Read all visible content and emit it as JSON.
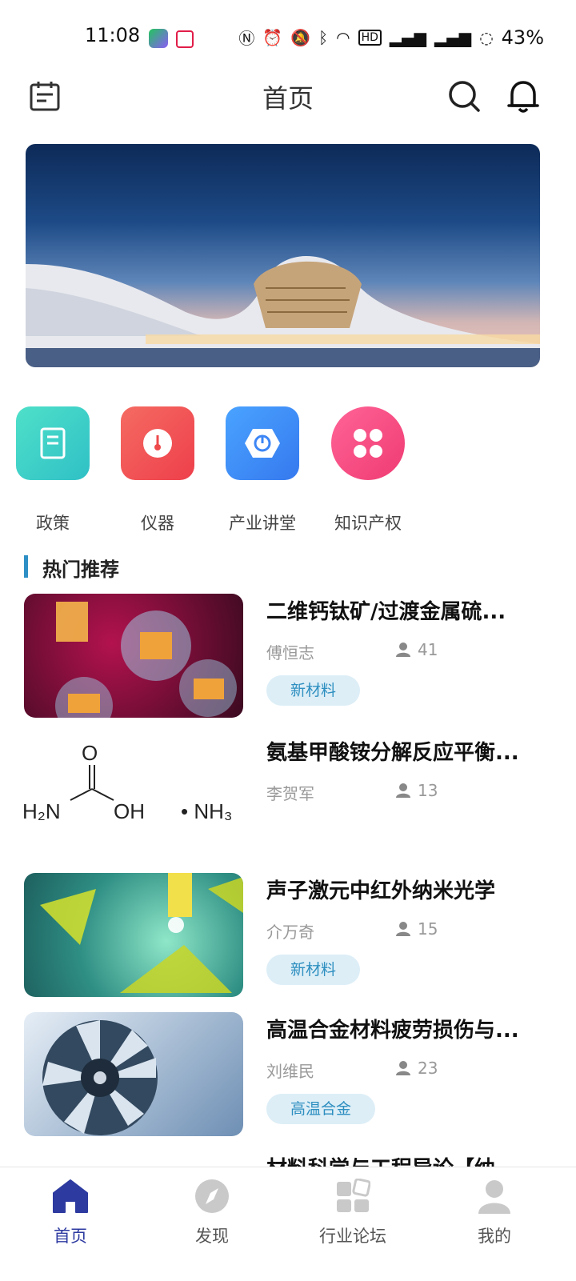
{
  "status_bar": {
    "time": "11:08",
    "battery": "43%",
    "icons": [
      "nfc-icon",
      "alarm-icon",
      "mute-icon",
      "bluetooth-icon",
      "wifi-icon",
      "hd-icon",
      "signal-4g-icon",
      "signal-5g-icon",
      "battery-icon"
    ]
  },
  "header": {
    "title": "首页"
  },
  "shortcuts": [
    {
      "label": "政策",
      "color": "#3fd0c4",
      "icon": "notebook-icon"
    },
    {
      "label": "仪器",
      "color": "#f0524f",
      "icon": "gauge-icon"
    },
    {
      "label": "产业讲堂",
      "color": "#3d86f5",
      "icon": "hexagon-play-icon"
    },
    {
      "label": "知识产权",
      "color": "#f14b82",
      "icon": "grid-icon"
    }
  ],
  "section": {
    "title": "热门推荐"
  },
  "articles": [
    {
      "title": "二维钙钛矿/过渡金属硫...",
      "author": "傅恒志",
      "views": "41",
      "tag": "新材料"
    },
    {
      "title": "氨基甲酸铵分解反应平衡...",
      "author": "李贺军",
      "views": "13",
      "tag": ""
    },
    {
      "title": "声子激元中红外纳米光学",
      "author": "介万奇",
      "views": "15",
      "tag": "新材料"
    },
    {
      "title": "高温合金材料疲劳损伤与...",
      "author": "刘维民",
      "views": "23",
      "tag": "高温合金"
    },
    {
      "title": "材料科学与工程导论【纳"
    }
  ],
  "formula": {
    "o": "O",
    "h2n": "H₂N",
    "oh": "OH",
    "nh3": "• NH₃"
  },
  "tabs": [
    {
      "label": "首页",
      "active": true
    },
    {
      "label": "发现",
      "active": false
    },
    {
      "label": "行业论坛",
      "active": false
    },
    {
      "label": "我的",
      "active": false
    }
  ],
  "colors": {
    "accent": "#2d3aa0",
    "section_bar": "#2d8fc5",
    "tag_bg": "#ddeef7",
    "tag_text": "#2e8fc0"
  }
}
